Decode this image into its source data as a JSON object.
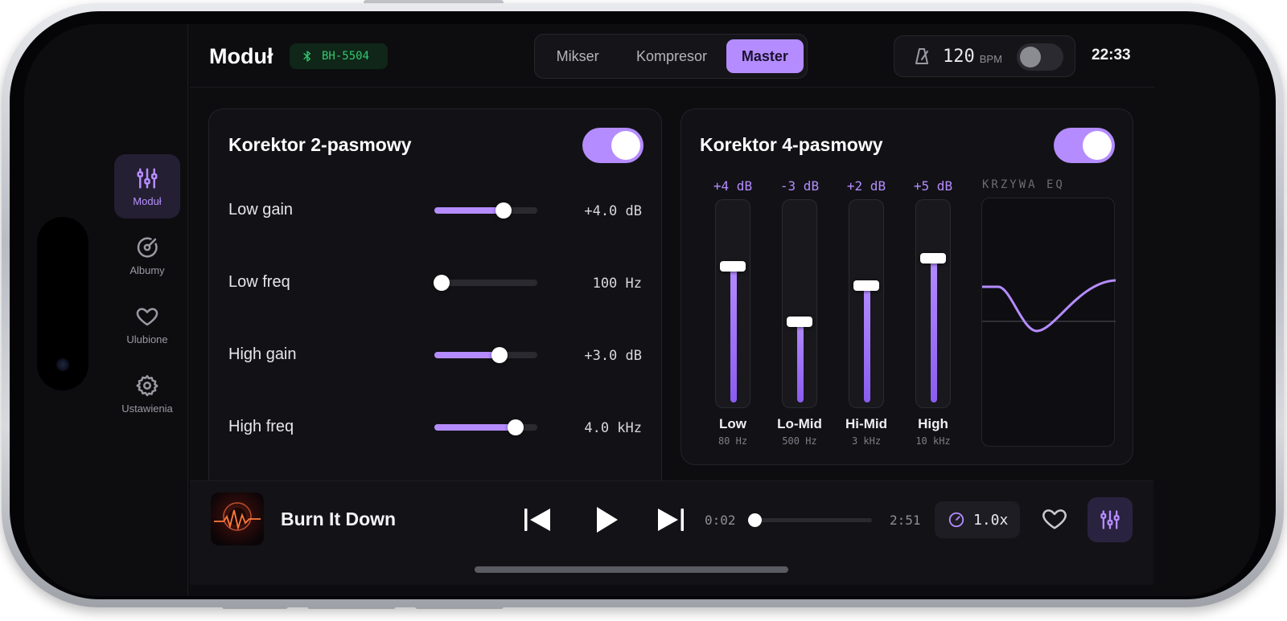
{
  "header": {
    "title": "Moduł",
    "device": "BH-5504",
    "tabs": [
      {
        "label": "Mikser",
        "active": false
      },
      {
        "label": "Kompresor",
        "active": false
      },
      {
        "label": "Master",
        "active": true
      }
    ],
    "bpm_value": "120",
    "bpm_unit": "BPM",
    "bpm_enabled": false,
    "clock": "22:33"
  },
  "sidebar": {
    "items": [
      {
        "label": "Moduł",
        "icon": "sliders-icon",
        "active": true
      },
      {
        "label": "Albumy",
        "icon": "disc-icon",
        "active": false
      },
      {
        "label": "Ulubione",
        "icon": "heart-icon",
        "active": false
      },
      {
        "label": "Ustawienia",
        "icon": "gear-icon",
        "active": false
      }
    ]
  },
  "eq2": {
    "title": "Korektor 2-pasmowy",
    "enabled": true,
    "rows": [
      {
        "label": "Low gain",
        "value": "+4.0 dB",
        "fraction": 0.67
      },
      {
        "label": "Low freq",
        "value": "100 Hz",
        "fraction": 0.07
      },
      {
        "label": "High gain",
        "value": "+3.0 dB",
        "fraction": 0.63
      },
      {
        "label": "High freq",
        "value": "4.0 kHz",
        "fraction": 0.79
      }
    ]
  },
  "eq4": {
    "title": "Korektor 4-pasmowy",
    "enabled": true,
    "curve_label": "KRZYWA EQ",
    "bands": [
      {
        "db": "+4 dB",
        "name": "Low",
        "freq": "80 Hz",
        "level": 0.7
      },
      {
        "db": "-3 dB",
        "name": "Lo-Mid",
        "freq": "500 Hz",
        "level": 0.42
      },
      {
        "db": "+2 dB",
        "name": "Hi-Mid",
        "freq": "3 kHz",
        "level": 0.6
      },
      {
        "db": "+5 dB",
        "name": "High",
        "freq": "10 kHz",
        "level": 0.74
      }
    ]
  },
  "player": {
    "song": "Burn It Down",
    "elapsed": "0:02",
    "duration": "2:51",
    "progress": 0.012,
    "speed": "1.0x"
  },
  "colors": {
    "accent": "#b58cff",
    "bluetooth": "#34c770",
    "background": "#0d0d10"
  }
}
